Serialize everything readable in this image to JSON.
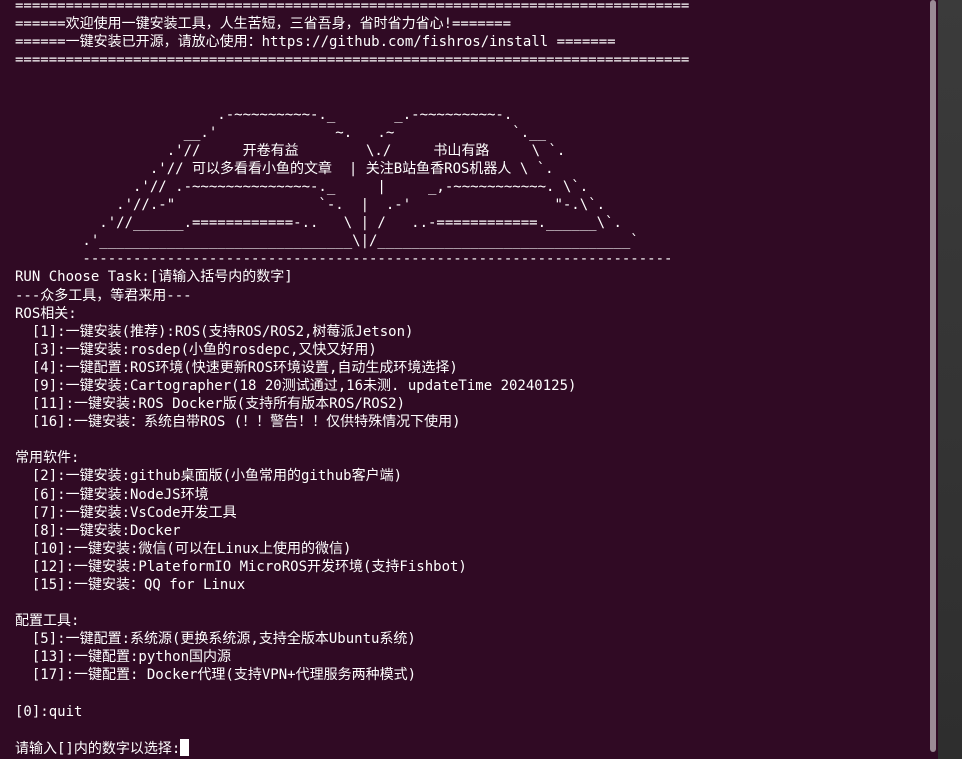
{
  "colors": {
    "background": "#300a24",
    "foreground": "#ffffff",
    "scrollbar": "#9b8a95"
  },
  "header": {
    "rule": "================================================================================",
    "welcome": "======欢迎使用一键安装工具，人生苦短，三省吾身，省时省力省心!=======",
    "opensource": "======一键安装已开源，请放心使用：https://github.com/fishros/install =======",
    "rule2": "================================================================================"
  },
  "banner": {
    "l1": "                        .-~~~~~~~~~-._       _.-~~~~~~~~~-.",
    "l2": "                    __.'              ~.   .~              `.__",
    "l3": "                  .'//     开卷有益        \\./     书山有路     \\ `.",
    "l4": "                .'// 可以多看看小鱼的文章  | 关注B站鱼香ROS机器人 \\ `.",
    "l5": "              .'// .-~~~~~~~~~~~~~~-._     |     _,-~~~~~~~~~~~. \\`.",
    "l6": "            .'//.-\"                 `-.  |  .-'                 \"-.\\`.",
    "l7": "          .'//______.============-..   \\ | /   ..-============.______\\`.",
    "l8": "        .'______________________________\\|/______________________________`",
    "l9": "        ----------------------------------------------------------------------"
  },
  "menu": {
    "prompt_title": "RUN Choose Task:[请输入括号内的数字]",
    "subtitle": "---众多工具，等君来用---",
    "ros_heading": "ROS相关:",
    "ros_items": [
      "  [1]:一键安装(推荐):ROS(支持ROS/ROS2,树莓派Jetson)",
      "  [3]:一键安装:rosdep(小鱼的rosdepc,又快又好用)",
      "  [4]:一键配置:ROS环境(快速更新ROS环境设置,自动生成环境选择)",
      "  [9]:一键安装:Cartographer(18 20测试通过,16未测. updateTime 20240125)",
      "  [11]:一键安装:ROS Docker版(支持所有版本ROS/ROS2)",
      "  [16]:一键安装：系统自带ROS (！！警告！！仅供特殊情况下使用)"
    ],
    "software_heading": "常用软件:",
    "software_items": [
      "  [2]:一键安装:github桌面版(小鱼常用的github客户端)",
      "  [6]:一键安装:NodeJS环境",
      "  [7]:一键安装:VsCode开发工具",
      "  [8]:一键安装:Docker",
      "  [10]:一键安装:微信(可以在Linux上使用的微信)",
      "  [12]:一键安装:PlateformIO MicroROS开发环境(支持Fishbot)",
      "  [15]:一键安装：QQ for Linux"
    ],
    "config_heading": "配置工具:",
    "config_items": [
      "  [5]:一键配置:系统源(更换系统源,支持全版本Ubuntu系统)",
      "  [13]:一键配置:python国内源",
      "  [17]:一键配置: Docker代理(支持VPN+代理服务两种模式)"
    ],
    "quit": "[0]:quit",
    "input_prompt": "请输入[]内的数字以选择:"
  }
}
